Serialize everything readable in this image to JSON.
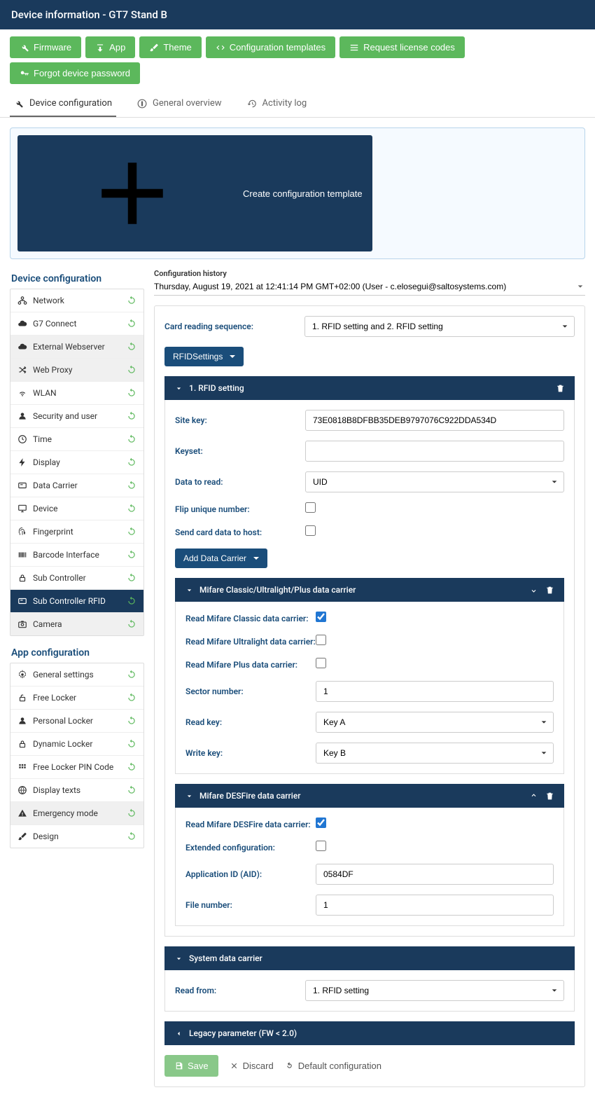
{
  "header": {
    "title": "Device information - GT7 Stand B"
  },
  "toolbar": {
    "firmware": "Firmware",
    "app": "App",
    "theme": "Theme",
    "configTemplates": "Configuration templates",
    "requestLicense": "Request license codes",
    "forgotPassword": "Forgot device password"
  },
  "tabs": {
    "deviceConfig": "Device configuration",
    "generalOverview": "General overview",
    "activityLog": "Activity log"
  },
  "createTemplate": "Create configuration template",
  "sidebar": {
    "deviceTitle": "Device configuration",
    "device": [
      "Network",
      "G7 Connect",
      "External Webserver",
      "Web Proxy",
      "WLAN",
      "Security and user",
      "Time",
      "Display",
      "Data Carrier",
      "Device",
      "Fingerprint",
      "Barcode Interface",
      "Sub Controller",
      "Sub Controller RFID",
      "Camera"
    ],
    "appTitle": "App configuration",
    "app": [
      "General settings",
      "Free Locker",
      "Personal Locker",
      "Dynamic Locker",
      "Free Locker PIN Code",
      "Display texts",
      "Emergency mode",
      "Design"
    ]
  },
  "history": {
    "label": "Configuration history",
    "value": "Thursday, August 19, 2021 at 12:41:14 PM GMT+02:00 (User - c.elosegui@saltosystems.com)"
  },
  "cardSeq": {
    "label": "Card reading sequence:",
    "value": "1. RFID setting and 2. RFID setting"
  },
  "rfidSettingsBtn": "RFIDSettings",
  "rfid1": {
    "title": "1. RFID setting",
    "siteKeyLabel": "Site key:",
    "siteKey": "73E0818B8DFBB35DEB9797076C922DDA534D",
    "keysetLabel": "Keyset:",
    "keyset": "",
    "dataToReadLabel": "Data to read:",
    "dataToRead": "UID",
    "flipLabel": "Flip unique number:",
    "sendHostLabel": "Send card data to host:",
    "addDataCarrier": "Add Data Carrier"
  },
  "mifareClassic": {
    "title": "Mifare Classic/Ultralight/Plus data carrier",
    "readClassicLabel": "Read Mifare Classic data carrier:",
    "readUltralightLabel": "Read Mifare Ultralight data carrier:",
    "readPlusLabel": "Read Mifare Plus data carrier:",
    "sectorLabel": "Sector number:",
    "sector": "1",
    "readKeyLabel": "Read key:",
    "readKey": "Key A",
    "writeKeyLabel": "Write key:",
    "writeKey": "Key B"
  },
  "desfire": {
    "title": "Mifare DESFire data carrier",
    "readLabel": "Read Mifare DESFire data carrier:",
    "extLabel": "Extended configuration:",
    "aidLabel": "Application ID (AID):",
    "aid": "0584DF",
    "fileLabel": "File number:",
    "file": "1"
  },
  "system": {
    "title": "System data carrier",
    "readFromLabel": "Read from:",
    "readFrom": "1. RFID setting"
  },
  "legacy": {
    "title": "Legacy parameter (FW < 2.0)"
  },
  "footer": {
    "save": "Save",
    "discard": "Discard",
    "default": "Default configuration"
  }
}
